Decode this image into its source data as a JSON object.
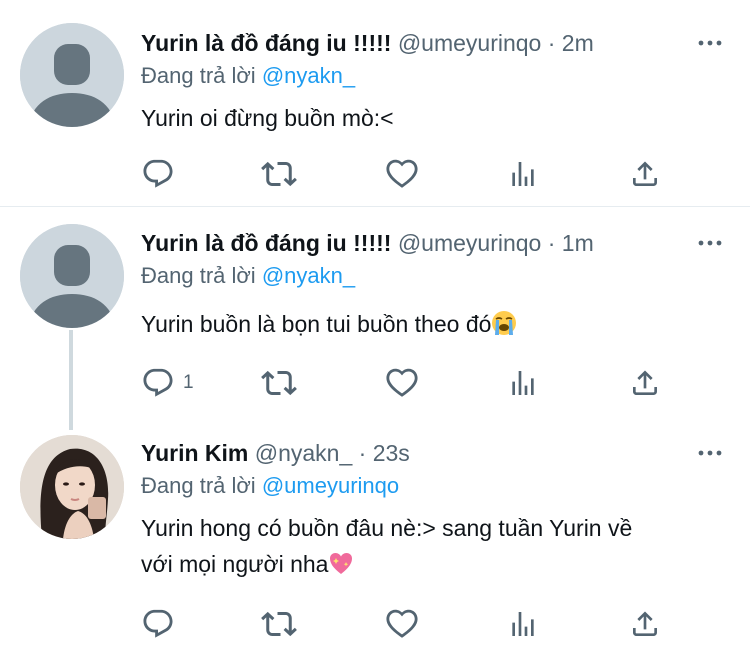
{
  "tweets": [
    {
      "name": "Yurin là đồ đáng iu !!!!!",
      "handle": "@umeyurinqo",
      "dot": "·",
      "time": "2m",
      "reply_prefix": "Đang trả lời",
      "reply_to": "@nyakn_",
      "text": "Yurin oi đừng buồn mò:<",
      "reply_count": ""
    },
    {
      "name": "Yurin là đồ đáng iu !!!!!",
      "handle": "@umeyurinqo",
      "dot": "·",
      "time": "1m",
      "reply_prefix": "Đang trả lời",
      "reply_to": "@nyakn_",
      "text": "Yurin buồn là bọn tui buồn theo đó",
      "text_emoji": "loudly-crying-face",
      "reply_count": "1"
    },
    {
      "name": "Yurin Kim",
      "handle": "@nyakn_",
      "dot": "·",
      "time": "23s",
      "reply_prefix": "Đang trả lời",
      "reply_to": "@umeyurinqo",
      "text_line1": "Yurin hong có buồn đâu nè:> sang tuần Yurin về",
      "text_line2": "với mọi người nha",
      "text_emoji": "sparkling-heart",
      "reply_count": ""
    }
  ],
  "icons": {
    "reply": "reply-icon",
    "retweet": "retweet-icon",
    "like": "like-icon",
    "views": "analytics-icon",
    "share": "share-icon",
    "more": "more-icon"
  },
  "colors": {
    "text": "#0f1419",
    "secondary": "#536471",
    "mention": "#1d9bf0",
    "avatar_placeholder": "#ccd6dd",
    "divider": "#e6ecf0"
  }
}
